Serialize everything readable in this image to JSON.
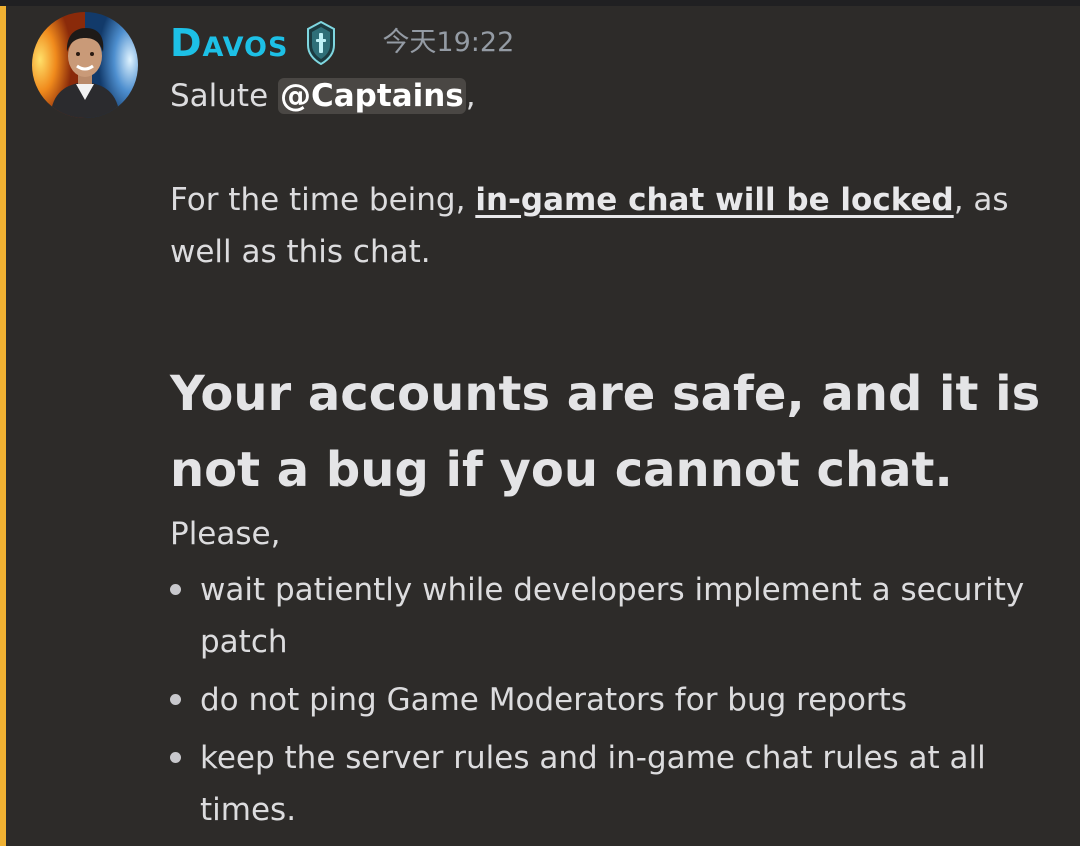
{
  "message": {
    "author": {
      "username": "Davos",
      "avatar_icon": "person-portrait-avatar",
      "role_icon": "moderator-shield-icon",
      "name_color": "#1dc0e6"
    },
    "timestamp": "今天19:22",
    "mention_accent_color": "#f0b132",
    "content": {
      "salute_prefix": "Salute ",
      "mention": "@Captains",
      "salute_suffix": ",",
      "notice_prefix": "For the time being, ",
      "notice_emphasis": "in-game chat will be locked",
      "notice_suffix": ", as well as this chat.",
      "heading": "Your accounts are safe, and it is not a bug if you cannot chat.",
      "please": "Please,",
      "bullets": [
        "wait patiently while developers implement a security patch",
        "do not ping Game Moderators for bug reports",
        "keep the server rules and in-game chat rules at all times."
      ]
    }
  }
}
